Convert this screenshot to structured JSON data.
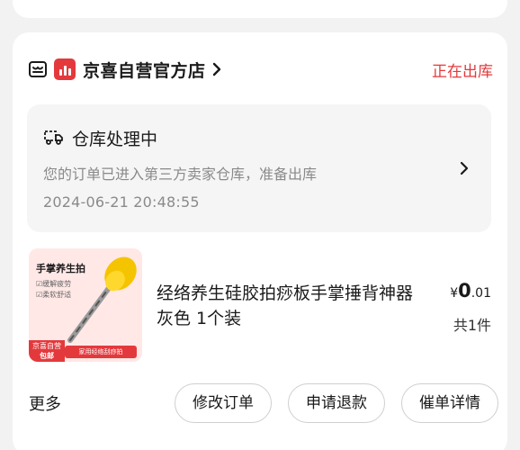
{
  "store": {
    "name": "京喜自营官方店",
    "status": "正在出库",
    "accent_color": "#e4393c"
  },
  "logistics": {
    "title": "仓库处理中",
    "description": "您的订单已进入第三方卖家仓库，准备出库",
    "timestamp": "2024-06-21 20:48:55"
  },
  "product": {
    "name": "经络养生硅胶拍痧板手掌捶背神器 灰色 1个装",
    "price_symbol": "¥",
    "price_int": "0",
    "price_dec": ".01",
    "quantity": "共1件",
    "thumbnail": {
      "title": "手掌养生拍",
      "feature_1": "☑缓解疲劳",
      "feature_2": "☑柔软舒适",
      "badge_1": "京喜自营",
      "badge_2": "包邮",
      "banner": "家用经络刮痧拍"
    }
  },
  "actions": {
    "more": "更多",
    "modify": "修改订单",
    "refund": "申请退款",
    "urge": "催单详情"
  }
}
